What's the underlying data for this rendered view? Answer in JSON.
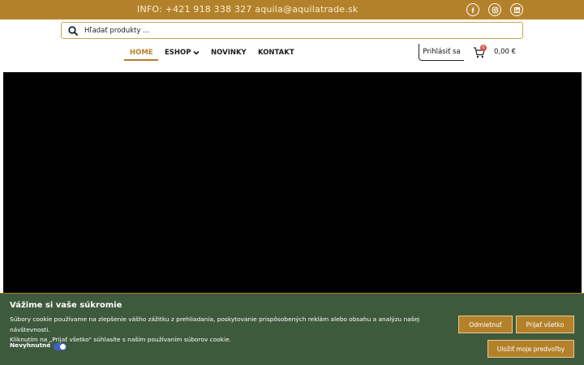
{
  "topbar": {
    "info": "INFO: +421 918 338 327 aquila@aquilatrade.sk",
    "social": [
      "facebook-icon",
      "instagram-icon",
      "linkedin-icon"
    ]
  },
  "search": {
    "placeholder": "Hľadať produkty ..."
  },
  "nav": {
    "items": [
      {
        "label": "HOME",
        "active": true
      },
      {
        "label": "ESHOP",
        "active": false
      },
      {
        "label": "NOVINKY",
        "active": false
      },
      {
        "label": "KONTAKT",
        "active": false
      }
    ]
  },
  "account": {
    "login_label": "Prihlásiť sa",
    "cart_count": "0",
    "cart_total": "0,00 €"
  },
  "cookie": {
    "title": "Vážime si vaše súkromie",
    "text_line1": "Súbory cookie používame na zlepšenie vášho zážitku z prehliadania, poskytovanie prispôsobených reklám alebo obsahu a analýzu našej návštevnosti.",
    "text_line2": "Kliknutím na „Prijať všetko\" súhlasíte s naším používaním súborov cookie.",
    "necessary_label": "Nevyhnutné",
    "reject_label": "Odmietnuť",
    "accept_label": "Prijať všetko",
    "save_label": "Uložiť moje predvoľby"
  },
  "colors": {
    "brand": "#b4812b",
    "banner": "#3e5a3c",
    "hero": "#000000"
  }
}
